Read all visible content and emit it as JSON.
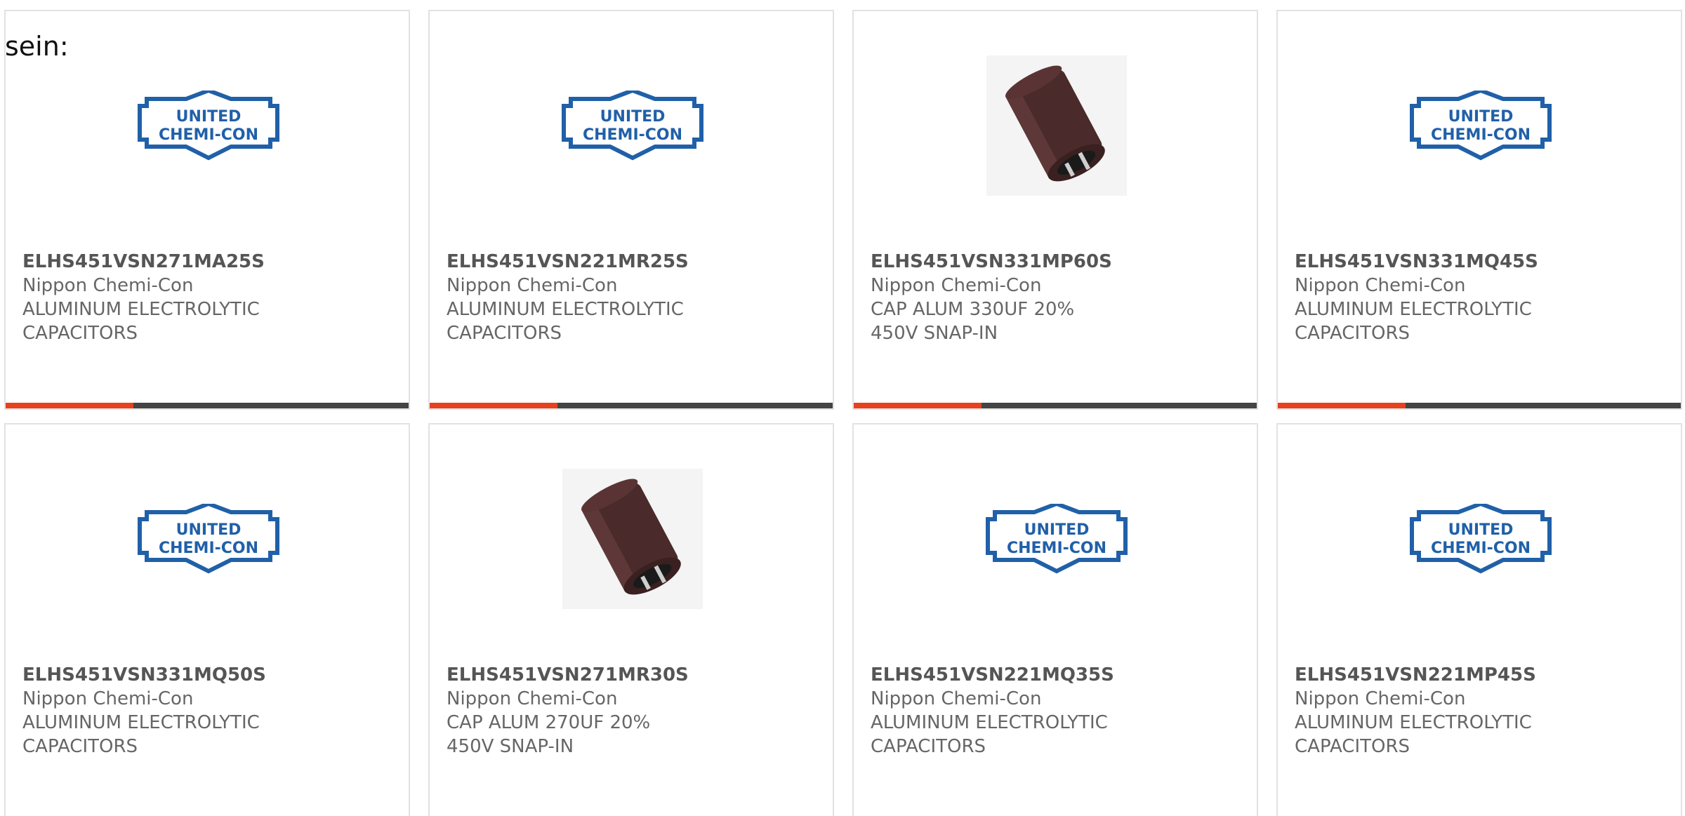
{
  "lead_text": "sein:",
  "colors": {
    "accent": "#e8411e",
    "bar_dark": "#444444",
    "logo_blue": "#2060a8",
    "card_border": "#e2e2e2"
  },
  "logo": {
    "line1": "UNITED",
    "line2": "CHEMI-CON"
  },
  "products": [
    {
      "part_number": "ELHS451VSN271MA25S",
      "manufacturer": "Nippon Chemi-Con",
      "description": "ALUMINUM ELECTROLYTIC CAPACITORS",
      "image": "united-chemi-con-logo"
    },
    {
      "part_number": "ELHS451VSN221MR25S",
      "manufacturer": "Nippon Chemi-Con",
      "description": "ALUMINUM ELECTROLYTIC CAPACITORS",
      "image": "united-chemi-con-logo"
    },
    {
      "part_number": "ELHS451VSN331MP60S",
      "manufacturer": "Nippon Chemi-Con",
      "description": "CAP ALUM 330UF 20% 450V SNAP-IN",
      "image": "capacitor-photo"
    },
    {
      "part_number": "ELHS451VSN331MQ45S",
      "manufacturer": "Nippon Chemi-Con",
      "description": "ALUMINUM ELECTROLYTIC CAPACITORS",
      "image": "united-chemi-con-logo"
    },
    {
      "part_number": "ELHS451VSN331MQ50S",
      "manufacturer": "Nippon Chemi-Con",
      "description": "ALUMINUM ELECTROLYTIC CAPACITORS",
      "image": "united-chemi-con-logo"
    },
    {
      "part_number": "ELHS451VSN271MR30S",
      "manufacturer": "Nippon Chemi-Con",
      "description": "CAP ALUM 270UF 20% 450V SNAP-IN",
      "image": "capacitor-photo"
    },
    {
      "part_number": "ELHS451VSN221MQ35S",
      "manufacturer": "Nippon Chemi-Con",
      "description": "ALUMINUM ELECTROLYTIC CAPACITORS",
      "image": "united-chemi-con-logo"
    },
    {
      "part_number": "ELHS451VSN221MP45S",
      "manufacturer": "Nippon Chemi-Con",
      "description": "ALUMINUM ELECTROLYTIC CAPACITORS",
      "image": "united-chemi-con-logo"
    }
  ]
}
